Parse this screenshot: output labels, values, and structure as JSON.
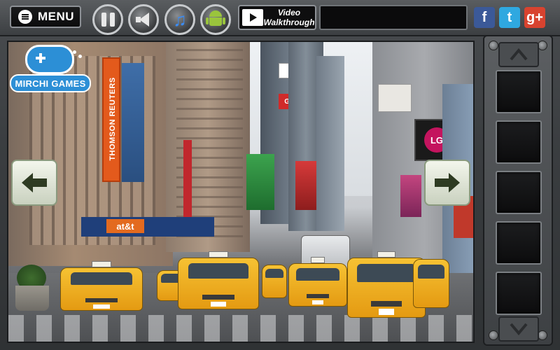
{
  "toolbar": {
    "menu_label": "MENU",
    "video_line1": "Video",
    "video_line2": "Walkthrough",
    "icons": [
      "pause-icon",
      "speaker-icon",
      "music-note-icon",
      "android-icon"
    ],
    "social": [
      {
        "name": "facebook",
        "glyph": "f",
        "color": "#3b5998"
      },
      {
        "name": "twitter",
        "glyph": "t",
        "color": "#2fa8e0"
      },
      {
        "name": "google-plus",
        "glyph": "g+",
        "color": "#d8432f"
      }
    ]
  },
  "logo": {
    "text": "MIRCHI GAMES"
  },
  "scene": {
    "signs": {
      "thomson": "THOMSON REUTERS",
      "att": "at&t",
      "lg": "LG",
      "grcc": "GRCC"
    }
  },
  "inventory": {
    "slot_count": 5
  },
  "colors": {
    "accent": "#2c8fd6",
    "taxi": "#f2b327",
    "arrow": "#2e3b22"
  }
}
